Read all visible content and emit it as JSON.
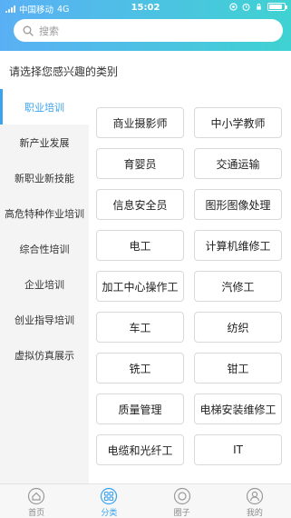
{
  "status_bar": {
    "carrier": "中国移动",
    "network": "4G",
    "time": "15:02",
    "battery_level": 0.85
  },
  "search": {
    "placeholder": "搜索"
  },
  "prompt": "请选择您感兴趣的类别",
  "sidebar": {
    "items": [
      {
        "label": "职业培训"
      },
      {
        "label": "新产业发展"
      },
      {
        "label": "新职业新技能"
      },
      {
        "label": "高危特种作业培训"
      },
      {
        "label": "综合性培训"
      },
      {
        "label": "企业培训"
      },
      {
        "label": "创业指导培训"
      },
      {
        "label": "虚拟仿真展示"
      }
    ],
    "active_index": 0
  },
  "categories": [
    {
      "label": "商业摄影师"
    },
    {
      "label": "中小学教师"
    },
    {
      "label": "育婴员"
    },
    {
      "label": "交通运输"
    },
    {
      "label": "信息安全员"
    },
    {
      "label": "图形图像处理"
    },
    {
      "label": "电工"
    },
    {
      "label": "计算机维修工"
    },
    {
      "label": "加工中心操作工"
    },
    {
      "label": "汽修工"
    },
    {
      "label": "车工"
    },
    {
      "label": "纺织"
    },
    {
      "label": "铣工"
    },
    {
      "label": "钳工"
    },
    {
      "label": "质量管理"
    },
    {
      "label": "电梯安装维修工"
    },
    {
      "label": "电缆和光纤工"
    },
    {
      "label": "IT"
    }
  ],
  "tab_bar": {
    "tabs": [
      {
        "label": "首页",
        "icon": "home-icon"
      },
      {
        "label": "分类",
        "icon": "category-icon"
      },
      {
        "label": "圈子",
        "icon": "circle-icon"
      },
      {
        "label": "我的",
        "icon": "profile-icon"
      }
    ],
    "active_index": 1
  },
  "colors": {
    "accent": "#3aa3ef",
    "gradient_start": "#5ab0f5",
    "gradient_end": "#3fd2d2"
  }
}
